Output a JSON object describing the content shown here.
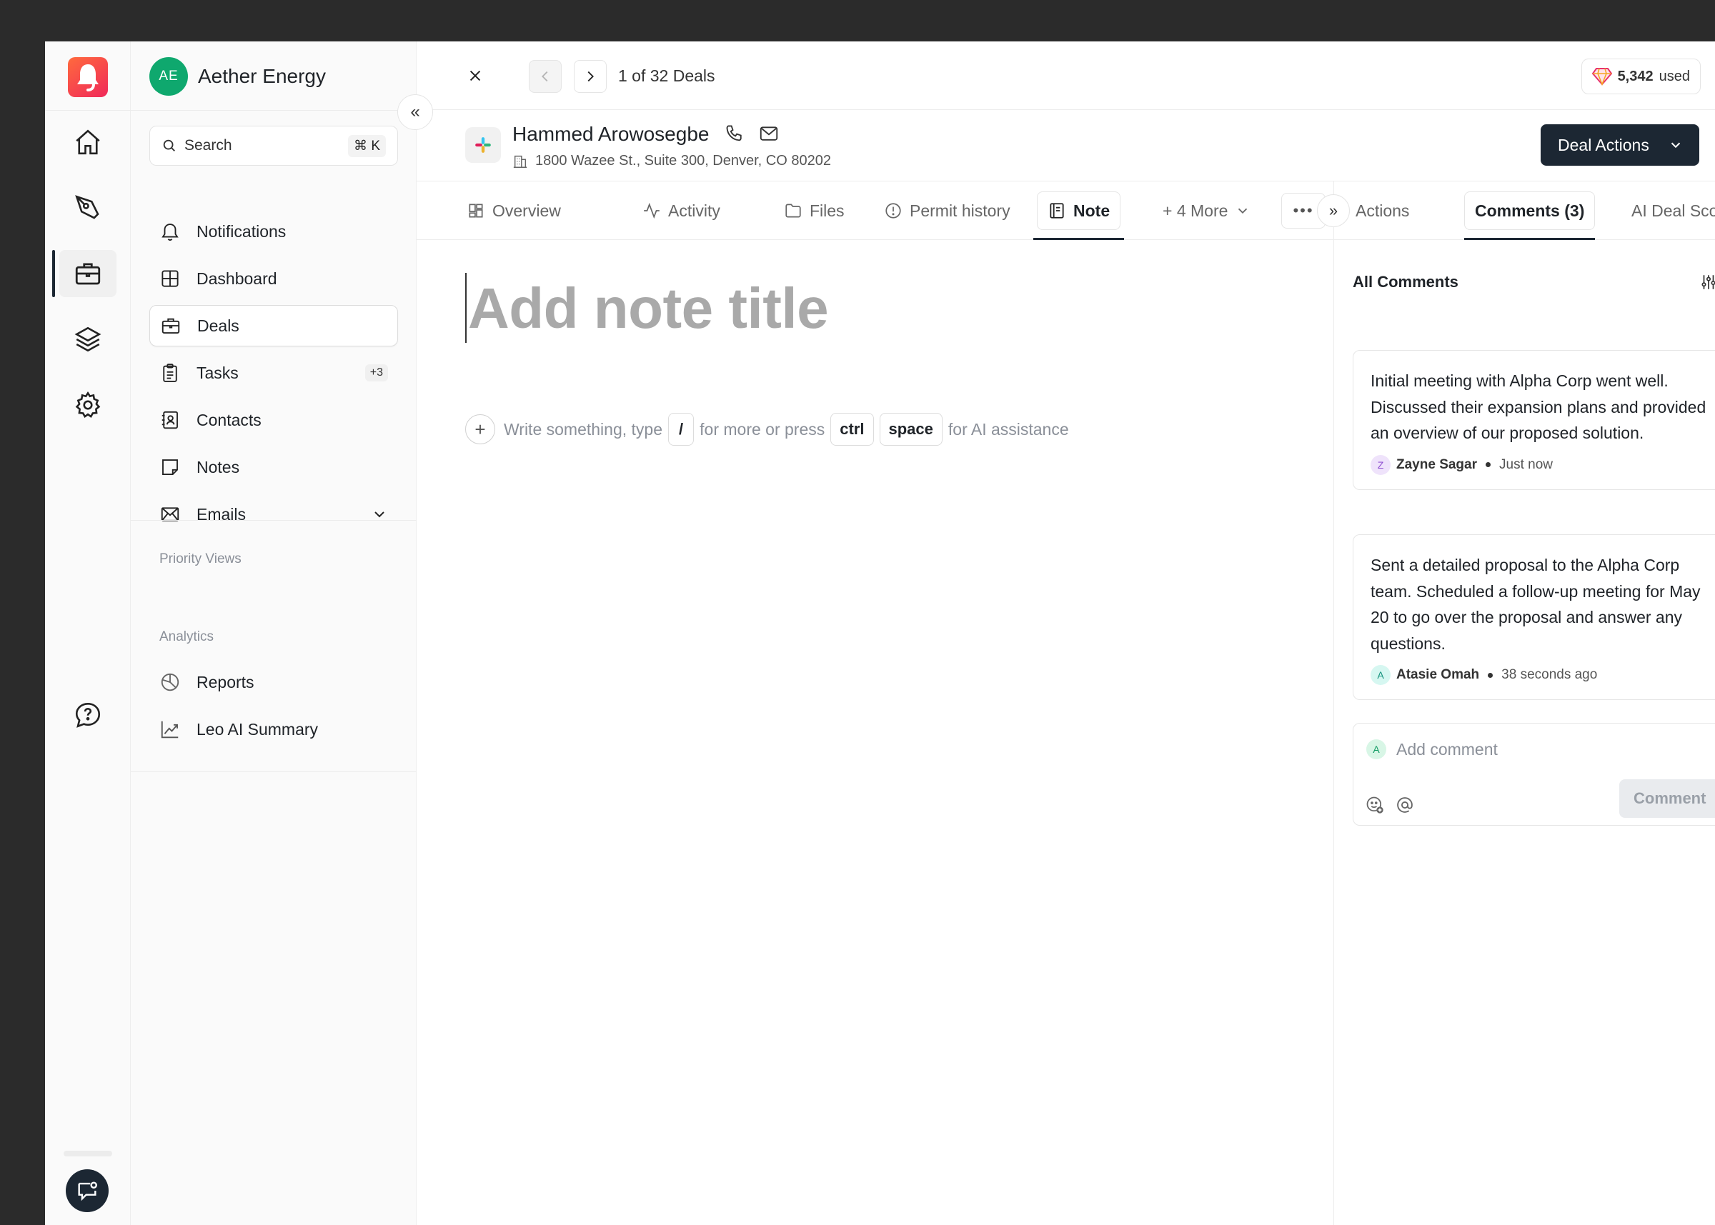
{
  "org": {
    "initials": "AE",
    "name": "Aether Energy"
  },
  "search": {
    "label": "Search",
    "shortcut": "⌘ K"
  },
  "nav": [
    {
      "label": "Notifications",
      "icon": "bell-icon"
    },
    {
      "label": "Dashboard",
      "icon": "grid-icon"
    },
    {
      "label": "Deals",
      "icon": "briefcase-icon",
      "active": true
    },
    {
      "label": "Tasks",
      "icon": "clipboard-icon",
      "badge": "+3"
    },
    {
      "label": "Contacts",
      "icon": "contact-book-icon"
    },
    {
      "label": "Notes",
      "icon": "note-icon"
    },
    {
      "label": "Emails",
      "icon": "mail-icon"
    }
  ],
  "sections": {
    "priority_views": "Priority Views",
    "analytics": "Analytics"
  },
  "analytics_items": [
    {
      "label": "Reports",
      "icon": "pie-chart-icon"
    },
    {
      "label": "Leo AI Summary",
      "icon": "trend-chart-icon"
    }
  ],
  "pager": {
    "text": "1 of 32 Deals"
  },
  "credits": {
    "value": "5,342",
    "suffix": "used"
  },
  "deal": {
    "person": "Hammed Arowosegbe",
    "address": "1800 Wazee St., Suite 300, Denver, CO 80202",
    "actions_label": "Deal Actions"
  },
  "tabs": [
    {
      "label": "Overview",
      "icon": "layout-icon"
    },
    {
      "label": "Activity",
      "icon": "activity-icon"
    },
    {
      "label": "Files",
      "icon": "folder-icon"
    },
    {
      "label": "Permit history",
      "icon": "alert-circle-icon"
    },
    {
      "label": "Note",
      "icon": "notebook-icon",
      "active": true
    },
    {
      "label": "+ 4 More",
      "icon": "chevron-down-icon"
    }
  ],
  "editor": {
    "title_placeholder": "Add note title",
    "hint_before": "Write something, type",
    "hint_slash": "/",
    "hint_middle": "for more or press",
    "hint_ctrl": "ctrl",
    "hint_space": "space",
    "hint_after": "for AI assistance"
  },
  "right_tabs": [
    {
      "label": "Actions"
    },
    {
      "label": "Comments (3)",
      "active": true
    },
    {
      "label": "AI Deal Score"
    }
  ],
  "comments": {
    "heading": "All Comments",
    "items": [
      {
        "text": "Initial meeting with Alpha Corp went well. Discussed their expansion plans and provided an overview of our proposed solution.",
        "initial": "Z",
        "author": "Zayne Sagar",
        "time": "Just now"
      },
      {
        "text": "Sent a detailed proposal to the Alpha Corp team. Scheduled a follow-up meeting for May 20 to go over the proposal and answer any questions.",
        "initial": "A",
        "author": "Atasie Omah",
        "time": "38 seconds ago"
      }
    ],
    "input": {
      "initial": "A",
      "placeholder": "Add comment",
      "button": "Comment"
    }
  },
  "colors": {
    "primary": "#1c2733",
    "brand": "#f0295a",
    "org_avatar": "#0fa86e"
  }
}
